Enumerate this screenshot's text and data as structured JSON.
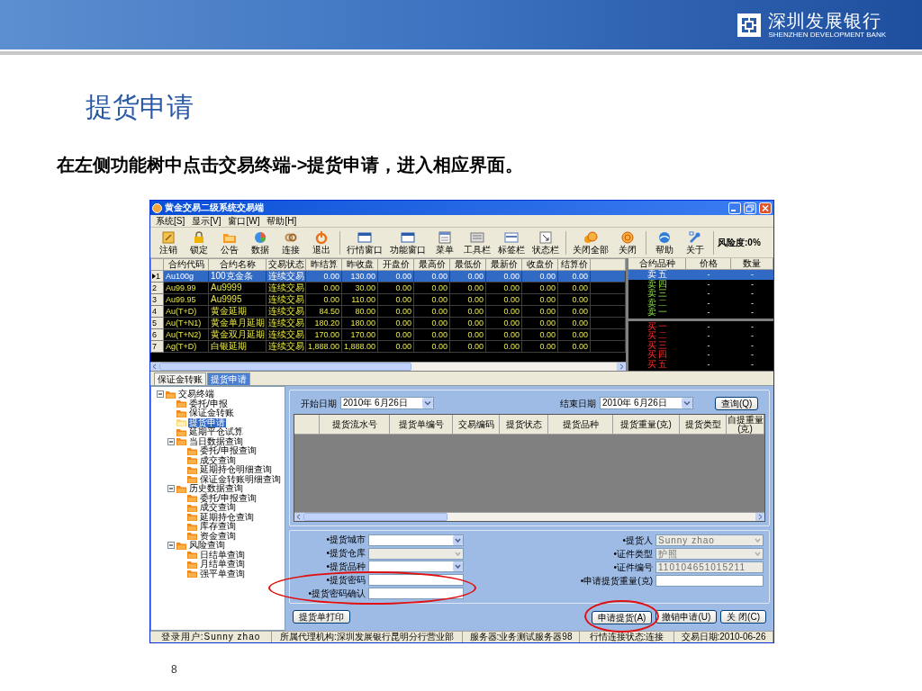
{
  "slide": {
    "brand": "深圳发展银行",
    "brand_en": "SHENZHEN DEVELOPMENT BANK",
    "title": "提货申请",
    "instruction": "在左侧功能树中点击交易终端->提货申请，进入相应界面。",
    "page_number": "8"
  },
  "window": {
    "title": "黄金交易二级系统交易端",
    "menu": [
      "系统[S]",
      "显示[V]",
      "窗口[W]",
      "帮助[H]"
    ],
    "toolbar": {
      "items": [
        {
          "label": "注销",
          "separator_before": false
        },
        {
          "label": "锁定",
          "separator_before": false
        },
        {
          "label": "公告",
          "separator_before": false
        },
        {
          "label": "数据",
          "separator_before": false
        },
        {
          "label": "连接",
          "separator_before": false
        },
        {
          "label": "退出",
          "separator_before": false
        },
        {
          "label": "行情窗口",
          "separator_before": true
        },
        {
          "label": "功能窗口",
          "separator_before": false
        },
        {
          "label": "菜单",
          "separator_before": false
        },
        {
          "label": "工具栏",
          "separator_before": false
        },
        {
          "label": "标签栏",
          "separator_before": false
        },
        {
          "label": "状态栏",
          "separator_before": false
        },
        {
          "label": "关闭全部",
          "separator_before": true
        },
        {
          "label": "关闭",
          "separator_before": false
        },
        {
          "label": "帮助",
          "separator_before": true
        },
        {
          "label": "关于",
          "separator_before": false
        }
      ],
      "risk": "风险度:0%"
    },
    "market": {
      "columns": [
        "合约代码",
        "合约名称",
        "交易状态",
        "昨结算",
        "昨收盘",
        "开盘价",
        "最高价",
        "最低价",
        "最新价",
        "收盘价",
        "结算价"
      ],
      "rows": [
        {
          "number": "1",
          "selected": true,
          "cells": [
            "Au100g",
            "100克金条",
            "连续交易",
            "0.00",
            "130.00",
            "0.00",
            "0.00",
            "0.00",
            "0.00",
            "0.00",
            "0.00"
          ]
        },
        {
          "number": "2",
          "selected": false,
          "cells": [
            "Au99.99",
            "Au9999",
            "连续交易",
            "0.00",
            "30.00",
            "0.00",
            "0.00",
            "0.00",
            "0.00",
            "0.00",
            "0.00"
          ]
        },
        {
          "number": "3",
          "selected": false,
          "cells": [
            "Au99.95",
            "Au9995",
            "连续交易",
            "0.00",
            "110.00",
            "0.00",
            "0.00",
            "0.00",
            "0.00",
            "0.00",
            "0.00"
          ]
        },
        {
          "number": "4",
          "selected": false,
          "cells": [
            "Au(T+D)",
            "黄金延期",
            "连续交易",
            "84.50",
            "80.00",
            "0.00",
            "0.00",
            "0.00",
            "0.00",
            "0.00",
            "0.00"
          ]
        },
        {
          "number": "5",
          "selected": false,
          "cells": [
            "Au(T+N1)",
            "黄金单月延期",
            "连续交易",
            "180.20",
            "180.00",
            "0.00",
            "0.00",
            "0.00",
            "0.00",
            "0.00",
            "0.00"
          ]
        },
        {
          "number": "6",
          "selected": false,
          "cells": [
            "Au(T+N2)",
            "黄金双月延期",
            "连续交易",
            "170.00",
            "170.00",
            "0.00",
            "0.00",
            "0.00",
            "0.00",
            "0.00",
            "0.00"
          ]
        },
        {
          "number": "7",
          "selected": false,
          "cells": [
            "Ag(T+D)",
            "白银延期",
            "连续交易",
            "1,888.00",
            "1,888.00",
            "0.00",
            "0.00",
            "0.00",
            "0.00",
            "0.00",
            "0.00"
          ]
        }
      ]
    },
    "depth": {
      "columns": [
        "合约品种",
        "价格",
        "数量"
      ],
      "rows": [
        {
          "kind": "sell",
          "label": "卖 五",
          "price": "-",
          "quantity": "-",
          "selected": true
        },
        {
          "kind": "sell",
          "label": "卖 四",
          "price": "-",
          "quantity": "-",
          "selected": false
        },
        {
          "kind": "sell",
          "label": "卖 三",
          "price": "-",
          "quantity": "-",
          "selected": false
        },
        {
          "kind": "sell",
          "label": "卖 二",
          "price": "-",
          "quantity": "-",
          "selected": false
        },
        {
          "kind": "sell",
          "label": "卖 一",
          "price": "-",
          "quantity": "-",
          "selected": false
        },
        {
          "kind": "buy",
          "label": "买 一",
          "price": "-",
          "quantity": "-",
          "selected": false
        },
        {
          "kind": "buy",
          "label": "买 二",
          "price": "-",
          "quantity": "-",
          "selected": false
        },
        {
          "kind": "buy",
          "label": "买 三",
          "price": "-",
          "quantity": "-",
          "selected": false
        },
        {
          "kind": "buy",
          "label": "买 四",
          "price": "-",
          "quantity": "-",
          "selected": false
        },
        {
          "kind": "buy",
          "label": "买 五",
          "price": "-",
          "quantity": "-",
          "selected": false
        }
      ]
    },
    "tabs": [
      {
        "label": "保证金转账",
        "selected": false
      },
      {
        "label": "提货申请",
        "selected": true
      }
    ],
    "tree": [
      {
        "label": "交易终端",
        "expanded": true,
        "selected": false,
        "children": [
          {
            "label": "委托/申报",
            "selected": false
          },
          {
            "label": "保证金转账",
            "selected": false
          },
          {
            "label": "提货申请",
            "selected": true
          },
          {
            "label": "延期平仓试算",
            "selected": false
          },
          {
            "label": "当日数据查询",
            "expanded": true,
            "selected": false,
            "children": [
              {
                "label": "委托/申报查询",
                "selected": false
              },
              {
                "label": "成交查询",
                "selected": false
              },
              {
                "label": "延期持仓明细查询",
                "selected": false
              },
              {
                "label": "保证金转账明细查询",
                "selected": false
              }
            ]
          },
          {
            "label": "历史数据查询",
            "expanded": true,
            "selected": false,
            "children": [
              {
                "label": "委托/申报查询",
                "selected": false
              },
              {
                "label": "成交查询",
                "selected": false
              },
              {
                "label": "延期持仓查询",
                "selected": false
              },
              {
                "label": "库存查询",
                "selected": false
              },
              {
                "label": "资金查询",
                "selected": false
              }
            ]
          },
          {
            "label": "风险查询",
            "expanded": true,
            "selected": false,
            "children": [
              {
                "label": "日结单查询",
                "selected": false
              },
              {
                "label": "月结单查询",
                "selected": false
              },
              {
                "label": "强平单查询",
                "selected": false
              }
            ]
          }
        ]
      }
    ],
    "query": {
      "start_label": "开始日期",
      "start_value": "2010年 6月26日",
      "end_label": "结束日期",
      "end_value": "2010年 6月26日",
      "button": "查询(Q)"
    },
    "grid_columns": [
      "提货流水号",
      "提货单编号",
      "交易编码",
      "提货状态",
      "提货品种",
      "提货重量(克)",
      "提货类型",
      "自提重量(克)"
    ],
    "form": {
      "left": [
        {
          "label": "•提货城市",
          "kind": "select",
          "disabled": false,
          "highlight": false
        },
        {
          "label": "•提货仓库",
          "kind": "select",
          "disabled": true,
          "highlight": false
        },
        {
          "label": "•提货品种",
          "kind": "select",
          "disabled": false,
          "highlight": false
        },
        {
          "label": "•提货密码",
          "kind": "input",
          "disabled": false,
          "highlight": true
        },
        {
          "label": "•提货密码确认",
          "kind": "input",
          "disabled": false,
          "highlight": true
        }
      ],
      "right": [
        {
          "label": "•提货人",
          "kind": "select",
          "value": "Sunny zhao",
          "disabled": true,
          "highlight": false
        },
        {
          "label": "•证件类型",
          "kind": "select",
          "value": "护照",
          "disabled": true,
          "highlight": false
        },
        {
          "label": "•证件编号",
          "kind": "input",
          "value": "110104651015211",
          "disabled": true,
          "highlight": false
        },
        {
          "label": "•申请提货重量(克)",
          "kind": "input",
          "disabled": false,
          "highlight": false
        }
      ]
    },
    "buttons": {
      "left": [
        {
          "label": "提货单打印",
          "highlight": false
        }
      ],
      "right": [
        {
          "label": "申请提货(A)",
          "highlight": true
        },
        {
          "label": "撤销申请(U)",
          "highlight": false
        },
        {
          "label": "关 闭(C)",
          "highlight": false
        }
      ]
    },
    "status_bar": [
      "登录用户:Sunny zhao",
      "所属代理机构:深圳发展银行昆明分行营业部",
      "服务器:业务测试服务器98",
      "行情连接状态:连接",
      "交易日期:2010-06-26"
    ]
  }
}
